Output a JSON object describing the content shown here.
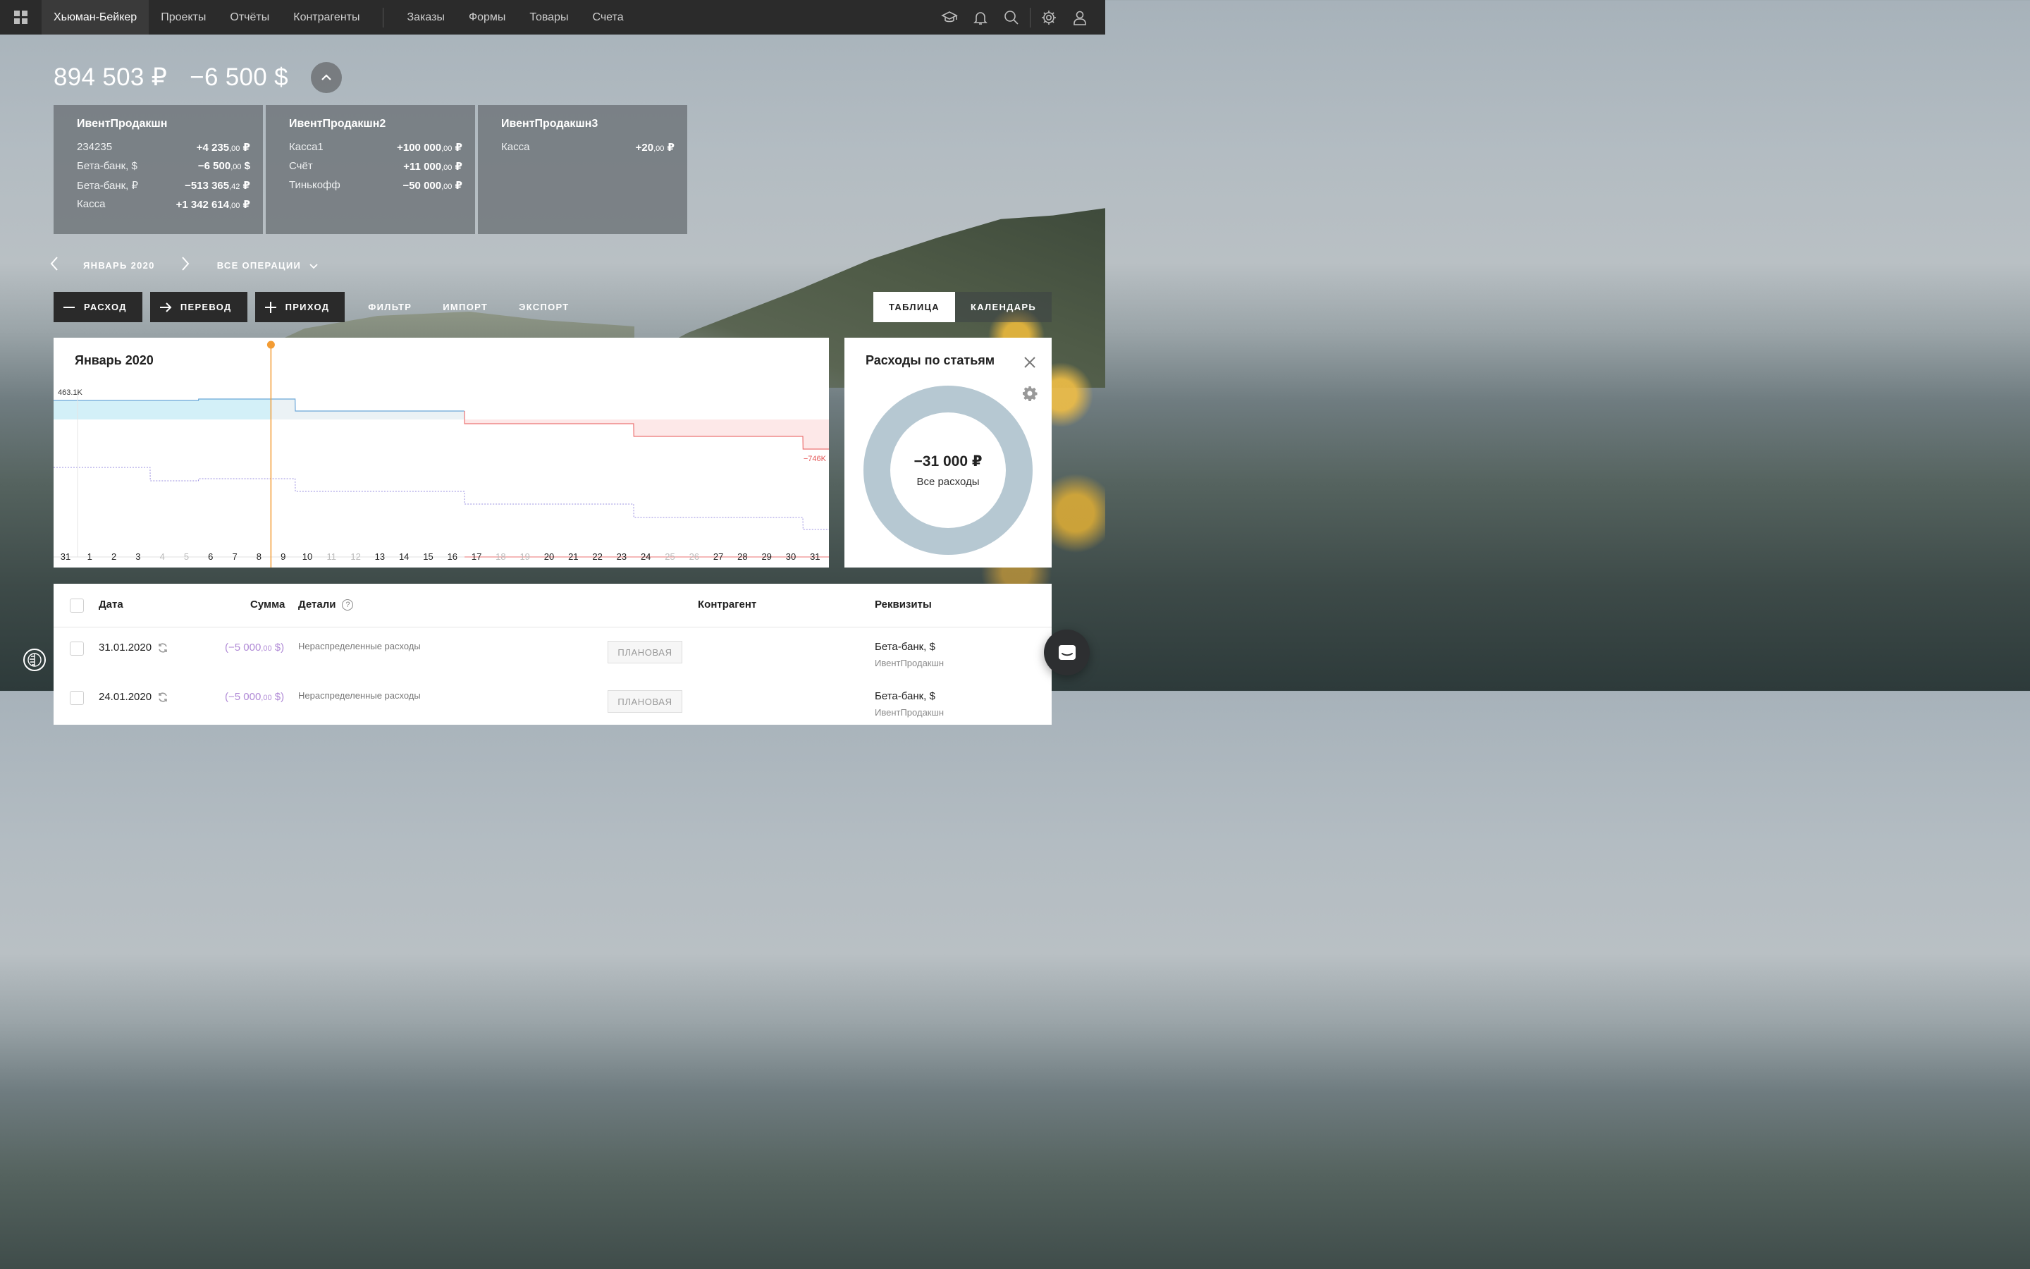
{
  "nav": {
    "company": "Хьюман-Бейкер",
    "items": [
      "Проекты",
      "Отчёты",
      "Контрагенты"
    ],
    "items2": [
      "Заказы",
      "Формы",
      "Товары",
      "Счета"
    ]
  },
  "totals": {
    "rub": "894 503 ₽",
    "usd": "−6 500 $"
  },
  "accounts": [
    {
      "name": "ИвентПродакшн",
      "rows": [
        {
          "label": "234235",
          "main": "+4 235",
          "cents": ",00",
          "cur": " ₽"
        },
        {
          "label": "Бета-банк, $",
          "main": "−6 500",
          "cents": ",00",
          "cur": " $"
        },
        {
          "label": "Бета-банк, ₽",
          "main": "−513 365",
          "cents": ",42",
          "cur": " ₽"
        },
        {
          "label": "Касса",
          "main": "+1 342 614",
          "cents": ",00",
          "cur": " ₽"
        }
      ]
    },
    {
      "name": "ИвентПродакшн2",
      "rows": [
        {
          "label": "Касса1",
          "main": "+100 000",
          "cents": ",00",
          "cur": " ₽"
        },
        {
          "label": "Счёт",
          "main": "+11 000",
          "cents": ",00",
          "cur": " ₽"
        },
        {
          "label": "Тинькофф",
          "main": "−50 000",
          "cents": ",00",
          "cur": " ₽"
        }
      ]
    },
    {
      "name": "ИвентПродакшн3",
      "rows": [
        {
          "label": "Касса",
          "main": "+20",
          "cents": ",00",
          "cur": " ₽"
        }
      ]
    }
  ],
  "period": {
    "label": "ЯНВАРЬ 2020",
    "operations": "ВСЕ ОПЕРАЦИИ"
  },
  "actions": {
    "expense": "РАСХОД",
    "transfer": "ПЕРЕВОД",
    "income": "ПРИХОД",
    "filter": "ФИЛЬТР",
    "import": "ИМПОРТ",
    "export": "ЭКСПОРТ"
  },
  "views": {
    "table": "ТАБЛИЦА",
    "calendar": "КАЛЕНДАРЬ"
  },
  "chart_data": {
    "type": "line",
    "title": "Январь 2020",
    "x": [
      "31",
      "1",
      "2",
      "3",
      "4",
      "5",
      "6",
      "7",
      "8",
      "9",
      "10",
      "11",
      "12",
      "13",
      "14",
      "15",
      "16",
      "17",
      "18",
      "19",
      "20",
      "21",
      "22",
      "23",
      "24",
      "25",
      "26",
      "27",
      "28",
      "29",
      "30",
      "31"
    ],
    "muted_days": [
      "4",
      "5",
      "11",
      "12",
      "18",
      "19",
      "25",
      "26"
    ],
    "current_day": "8",
    "labels": {
      "max": "463.1K",
      "min": "−746K"
    },
    "series": [
      {
        "values": [
          463.1,
          463.1,
          463.1,
          463.1,
          463.1,
          463.1,
          468,
          468,
          468,
          468,
          420,
          420,
          420,
          420,
          420,
          420,
          420,
          310,
          310,
          310,
          310,
          310,
          310,
          310,
          210,
          210,
          210,
          210,
          210,
          210,
          210,
          14
        ]
      },
      {
        "values": [
          -50,
          -50,
          -50,
          -50,
          -165,
          -165,
          -150,
          -150,
          -150,
          -150,
          -260,
          -260,
          -260,
          -260,
          -260,
          -260,
          -260,
          -370,
          -370,
          -370,
          -370,
          -370,
          -370,
          -370,
          -480,
          -480,
          -480,
          -480,
          -480,
          -480,
          -480,
          -746
        ]
      }
    ]
  },
  "donut": {
    "title": "Расходы по статьям",
    "value": "−31 000 ₽",
    "caption": "Все расходы",
    "color": "#b6c8d2"
  },
  "table": {
    "headers": {
      "date": "Дата",
      "sum": "Сумма",
      "details": "Детали",
      "counterparty": "Контрагент",
      "requisites": "Реквизиты"
    },
    "rows": [
      {
        "date": "31.01.2020",
        "sum_main": "(−5 000",
        "sum_cents": ",00",
        "sum_cur": " $)",
        "details": "Нераспределенные расходы",
        "badge": "ПЛАНОВАЯ",
        "account": "Бета-банк, $",
        "org": "ИвентПродакшн"
      },
      {
        "date": "24.01.2020",
        "sum_main": "(−5 000",
        "sum_cents": ",00",
        "sum_cur": " $)",
        "details": "Нераспределенные расходы",
        "badge": "ПЛАНОВАЯ",
        "account": "Бета-банк, $",
        "org": "ИвентПродакшн"
      }
    ]
  }
}
